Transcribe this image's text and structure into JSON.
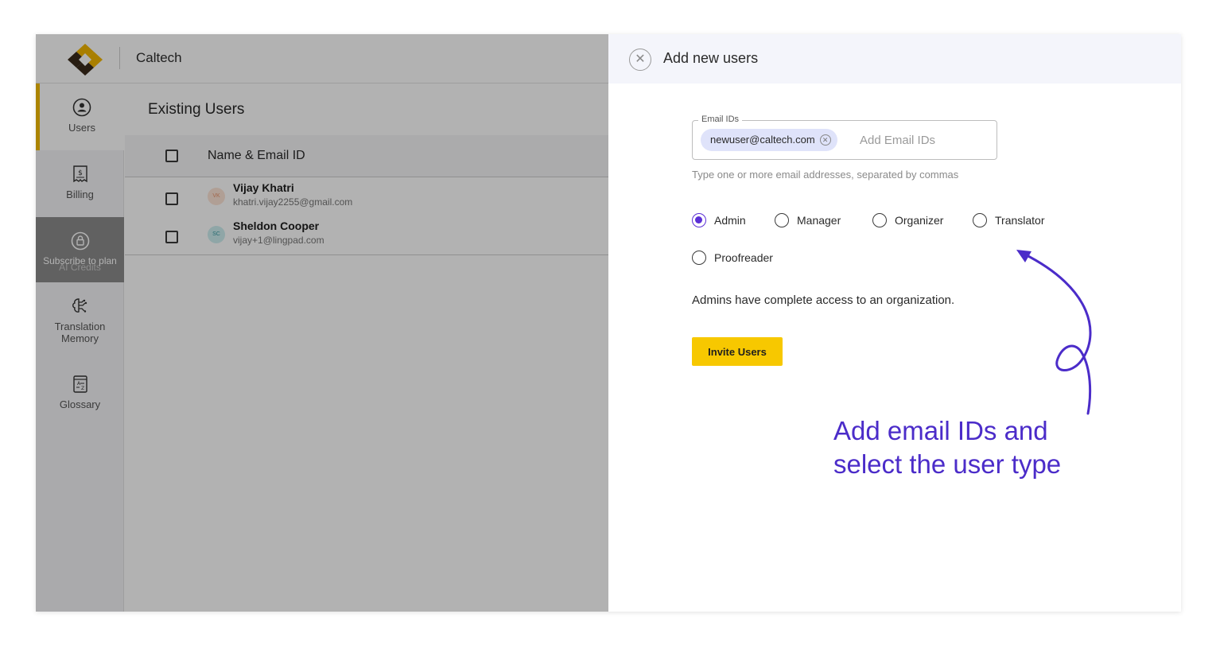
{
  "topbar": {
    "org_name": "Caltech"
  },
  "sidebar": {
    "items": [
      {
        "label": "Users",
        "icon": "user-circle-icon"
      },
      {
        "label": "Billing",
        "icon": "billing-icon"
      },
      {
        "label": "AI Credits",
        "icon": "lock-icon",
        "overlay": "Subscribe to plan"
      },
      {
        "label": "Translation Memory",
        "icon": "brain-icon"
      },
      {
        "label": "Glossary",
        "icon": "glossary-icon"
      }
    ]
  },
  "main": {
    "title": "Existing Users",
    "table": {
      "header": "Name & Email ID",
      "rows": [
        {
          "initials": "VK",
          "name": "Vijay Khatri",
          "email": "khatri.vijay2255@gmail.com"
        },
        {
          "initials": "SC",
          "name": "Sheldon Cooper",
          "email": "vijay+1@lingpad.com"
        }
      ]
    }
  },
  "panel": {
    "title": "Add new users",
    "email_field": {
      "legend": "Email IDs",
      "chips": [
        "newuser@caltech.com"
      ],
      "placeholder": "Add Email IDs",
      "helper": "Type one or more email addresses, separated by commas"
    },
    "roles": [
      {
        "label": "Admin",
        "checked": true
      },
      {
        "label": "Manager",
        "checked": false
      },
      {
        "label": "Organizer",
        "checked": false
      },
      {
        "label": "Translator",
        "checked": false
      },
      {
        "label": "Proofreader",
        "checked": false
      }
    ],
    "role_description": "Admins have complete access to an organization.",
    "invite_button": "Invite Users"
  },
  "annotation": {
    "line1": "Add email IDs and",
    "line2": "select the user type"
  },
  "colors": {
    "accent_yellow": "#f7c800",
    "accent_purple": "#5b2fd6",
    "annotation_purple": "#4b2cc9"
  }
}
